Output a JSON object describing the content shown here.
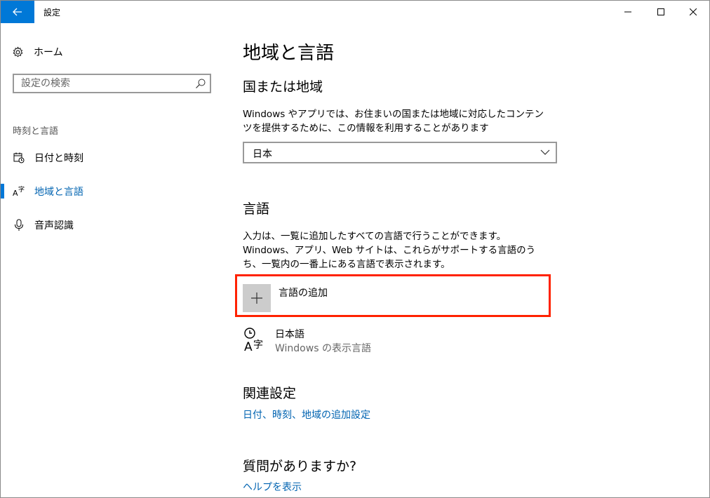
{
  "titlebar": {
    "title": "設定",
    "icons": {
      "back": "back-arrow-icon",
      "minimize": "minimize-icon",
      "maximize": "maximize-icon",
      "close": "close-icon"
    }
  },
  "sidebar": {
    "home_label": "ホーム",
    "search_placeholder": "設定の検索",
    "section_label": "時刻と言語",
    "items": [
      {
        "label": "日付と時刻",
        "icon": "calendar-clock-icon",
        "active": false
      },
      {
        "label": "地域と言語",
        "icon": "region-language-icon",
        "active": true
      },
      {
        "label": "音声認識",
        "icon": "microphone-icon",
        "active": false
      }
    ]
  },
  "main": {
    "title": "地域と言語",
    "region": {
      "heading": "国または地域",
      "description": "Windows やアプリでは、お住まいの国または地域に対応したコンテンツを提供するために、この情報を利用することがあります",
      "selected": "日本"
    },
    "language": {
      "heading": "言語",
      "description": "入力は、一覧に追加したすべての言語で行うことができます。Windows、アプリ、Web サイトは、これらがサポートする言語のうち、一覧内の一番上にある言語で表示されます。",
      "add_label": "言語の追加",
      "items": [
        {
          "name": "日本語",
          "subtitle": "Windows の表示言語"
        }
      ]
    },
    "related": {
      "heading": "関連設定",
      "link": "日付、時刻、地域の追加設定"
    },
    "question": {
      "heading": "質問がありますか?",
      "link": "ヘルプを表示"
    }
  },
  "colors": {
    "accent": "#0078d7",
    "link": "#0063b1",
    "highlight": "#ff2200"
  }
}
